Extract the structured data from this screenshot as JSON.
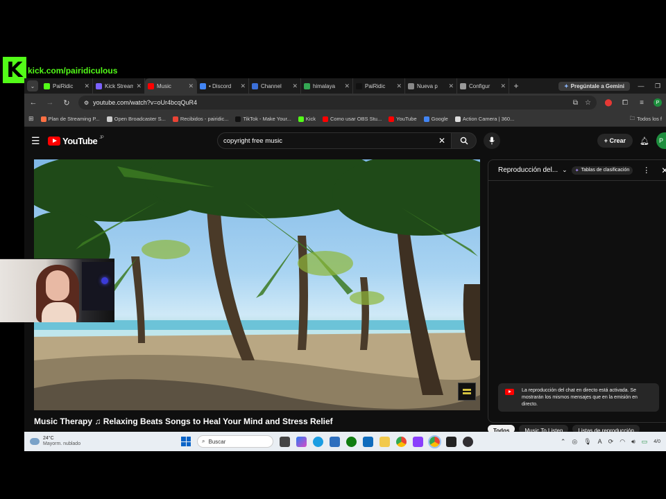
{
  "overlay": {
    "kick_logo": "K",
    "kick_url": "kick.com/pairidiculous"
  },
  "tabs": [
    {
      "title": "PaiRidic",
      "icon": "kick-icon",
      "color": "#53fc18",
      "active": false
    },
    {
      "title": "Kick Stream",
      "icon": "kick-studio-icon",
      "color": "#7b61ff",
      "active": false
    },
    {
      "title": "Music",
      "icon": "youtube-icon",
      "color": "#ff0000",
      "active": true
    },
    {
      "title": "• Discord",
      "icon": "chrome-icon",
      "color": "#4285f4",
      "active": false
    },
    {
      "title": "Channel",
      "icon": "restream-icon",
      "color": "#3b6fd8",
      "active": false
    },
    {
      "title": "himalaya",
      "icon": "google-icon",
      "color": "#34a853",
      "active": false
    },
    {
      "title": "PaiRidic",
      "icon": "tiktok-icon",
      "color": "#111111",
      "active": false
    },
    {
      "title": "Nueva p",
      "icon": "chrome-icon",
      "color": "#888888",
      "active": false
    },
    {
      "title": "Configur",
      "icon": "gear-icon",
      "color": "#999999",
      "active": false
    }
  ],
  "gemini_label": "Pregúntale a Gemini",
  "address": {
    "url": "youtube.com/watch?v=oUr4bcqQuR4"
  },
  "bookmarks": [
    {
      "label": "Plan de Streaming P...",
      "color": "#ff7043"
    },
    {
      "label": "Open Broadcaster S...",
      "color": "#cccccc"
    },
    {
      "label": "Recibidos - pairidic...",
      "color": "#ea4335"
    },
    {
      "label": "TikTok - Make Your...",
      "color": "#111111"
    },
    {
      "label": "Kick",
      "color": "#53fc18"
    },
    {
      "label": "Como usar OBS Stu...",
      "color": "#ff0000"
    },
    {
      "label": "YouTube",
      "color": "#ff0000"
    },
    {
      "label": "Google",
      "color": "#4285f4"
    },
    {
      "label": "Action Camera | 360...",
      "color": "#dddddd"
    }
  ],
  "bookmarks_folder": "Todos los f",
  "youtube": {
    "logo_text": "YouTube",
    "logo_region": "JP",
    "search_query": "copyright free music",
    "create_label": "Crear",
    "avatar_letter": "P",
    "video_title": "Music Therapy ♫ Relaxing Beats Songs to Heal Your Mind and Stress Relief"
  },
  "chat": {
    "title": "Reproducción del...",
    "badge": "Tablas de clasificación",
    "notice": "La reproducción del chat en directo está activada. Se mostrarán los mismos mensajes que en la emisión en directo."
  },
  "chips": [
    {
      "label": "Todos",
      "active": true
    },
    {
      "label": "Music To Listen",
      "active": false
    },
    {
      "label": "Listas de reproducción",
      "active": false
    }
  ],
  "taskbar": {
    "temperature": "24°C",
    "weather": "Mayorm. nublado",
    "search_placeholder": "Buscar",
    "time": "4/0"
  }
}
